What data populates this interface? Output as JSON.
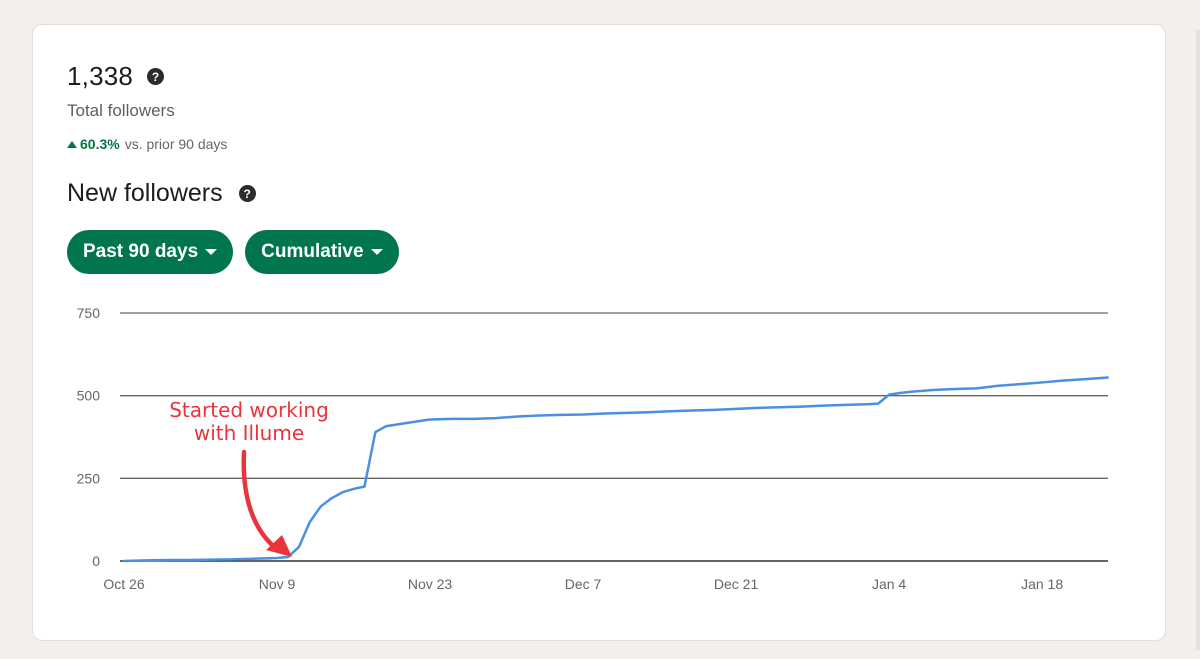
{
  "total": {
    "value": "1,338",
    "label": "Total followers",
    "change_pct": "60.3%",
    "change_text": "vs. prior 90 days"
  },
  "section": {
    "title": "New followers"
  },
  "filters": {
    "range": "Past 90 days",
    "mode": "Cumulative"
  },
  "annotation": {
    "line1": "Started working",
    "line2": "with Illume"
  },
  "colors": {
    "accent": "#01754f",
    "line": "#4a90e2",
    "annotation": "#e8343a",
    "positive": "#057642"
  },
  "chart_data": {
    "type": "line",
    "ylim": [
      0,
      750
    ],
    "y_ticks": [
      "750",
      "500",
      "250",
      "0"
    ],
    "x_tick_labels": [
      "Oct 26",
      "Nov 9",
      "Nov 23",
      "Dec 7",
      "Dec 21",
      "Jan 4",
      "Jan 18"
    ],
    "x_days": [
      0,
      2,
      4,
      6,
      8,
      10,
      11,
      12,
      13,
      14,
      15,
      16,
      17,
      18,
      19,
      20,
      21,
      22,
      23,
      24,
      26,
      28,
      30,
      32,
      34,
      36,
      38,
      40,
      42,
      44,
      46,
      48,
      50,
      52,
      54,
      56,
      58,
      60,
      62,
      64,
      66,
      68,
      69,
      70,
      71,
      72,
      74,
      76,
      78,
      80,
      82,
      84,
      86,
      88,
      90
    ],
    "series": [
      {
        "values": [
          0,
          2,
          3,
          3,
          4,
          5,
          6,
          7,
          8,
          9,
          12,
          42,
          118,
          165,
          190,
          208,
          218,
          225,
          390,
          408,
          418,
          428,
          430,
          430,
          432,
          437,
          440,
          442,
          443,
          446,
          448,
          450,
          453,
          455,
          457,
          460,
          463,
          465,
          467,
          470,
          472,
          474,
          476,
          503,
          508,
          512,
          517,
          520,
          522,
          530,
          535,
          540,
          546,
          550,
          555
        ]
      }
    ]
  }
}
